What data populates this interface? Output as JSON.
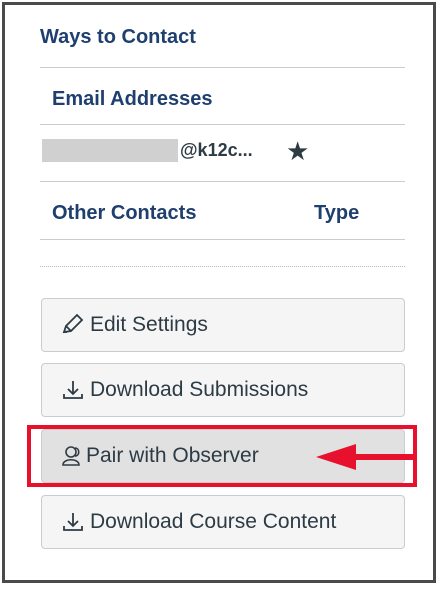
{
  "contact": {
    "ways_title": "Ways to Contact",
    "email_title": "Email Addresses",
    "email_visible": "@k12c...",
    "other_contacts": "Other Contacts",
    "type_label": "Type"
  },
  "buttons": {
    "edit_settings": "Edit Settings",
    "download_submissions": "Download Submissions",
    "pair_observer": "Pair with Observer",
    "download_course_content": "Download Course Content"
  },
  "icons": {
    "star": "star-icon",
    "edit": "pencil-icon",
    "download": "download-icon",
    "observer": "user-pair-icon",
    "arrow": "red-arrow-pointer-icon"
  },
  "colors": {
    "heading": "#1f3f6e",
    "text": "#2d3b45",
    "highlight": "#e8112d"
  }
}
